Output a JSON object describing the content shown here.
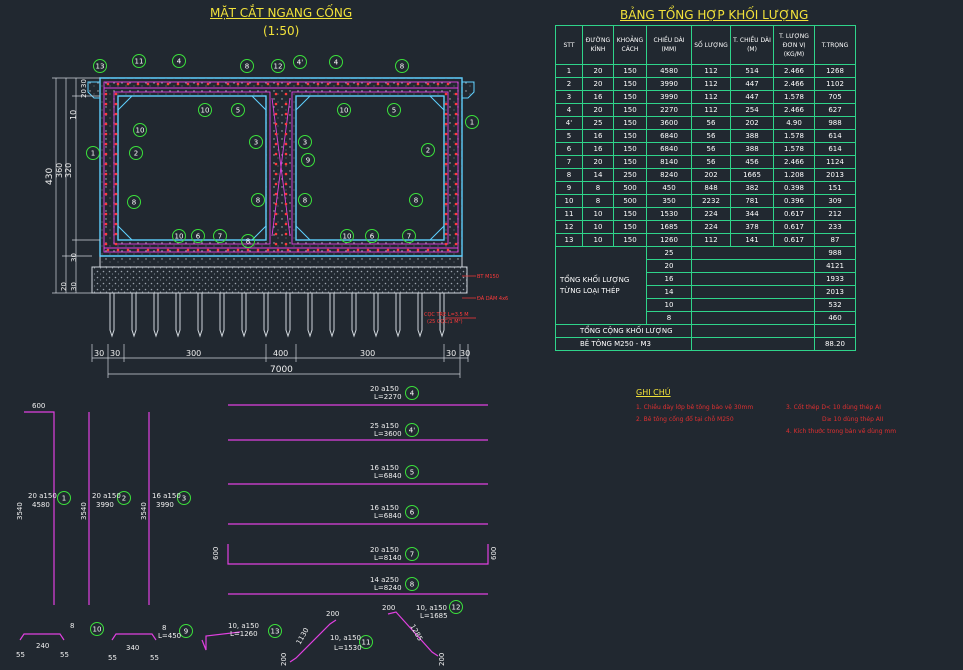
{
  "drawing": {
    "section_title": "MẶT CẮT NGANG CỐNG",
    "section_scale": "(1:50)",
    "table_title": "BẢNG TỔNG HỢP KHỐI LƯỢNG",
    "dims_left": [
      "430",
      "20",
      "30",
      "10",
      "320",
      "360",
      "30",
      "20",
      "30"
    ],
    "dims_bottom": [
      "30",
      "30",
      "300",
      "400",
      "300",
      "30",
      "30"
    ],
    "dim_total": "7000",
    "annotations": [
      "BT M150",
      "ĐÁ DĂM 4x6",
      "CỌC TRE L=3.5 M",
      "(25 CỌC/1 M²)"
    ],
    "bubbles_top": [
      "13",
      "11",
      "4",
      "8",
      "12",
      "4'",
      "4",
      "8"
    ],
    "bubbles_mid": [
      "5",
      "10",
      "5",
      "10",
      "10",
      "1",
      "2",
      "3",
      "3",
      "9",
      "2",
      "1",
      "8",
      "8",
      "8",
      "8"
    ],
    "bubbles_low": [
      "10",
      "6",
      "7",
      "8",
      "10",
      "6",
      "7"
    ]
  },
  "table": {
    "headers": [
      "STT",
      "ĐƯỜNG KÍNH",
      "KHOẢNG CÁCH",
      "CHIỀU DÀI (MM)",
      "SỐ LƯỢNG",
      "T. CHIỀU DÀI (M)",
      "T. LƯỢNG ĐƠN VỊ (KG/M)",
      "T.TRỌNG"
    ],
    "rows": [
      [
        "1",
        "20",
        "150",
        "4580",
        "112",
        "514",
        "2.466",
        "1268"
      ],
      [
        "2",
        "20",
        "150",
        "3990",
        "112",
        "447",
        "2.466",
        "1102"
      ],
      [
        "3",
        "16",
        "150",
        "3990",
        "112",
        "447",
        "1.578",
        "705"
      ],
      [
        "4",
        "20",
        "150",
        "2270",
        "112",
        "254",
        "2.466",
        "627"
      ],
      [
        "4'",
        "25",
        "150",
        "3600",
        "56",
        "202",
        "4.90",
        "988"
      ],
      [
        "5",
        "16",
        "150",
        "6840",
        "56",
        "388",
        "1.578",
        "614"
      ],
      [
        "6",
        "16",
        "150",
        "6840",
        "56",
        "388",
        "1.578",
        "614"
      ],
      [
        "7",
        "20",
        "150",
        "8140",
        "56",
        "456",
        "2.466",
        "1124"
      ],
      [
        "8",
        "14",
        "250",
        "8240",
        "202",
        "1665",
        "1.208",
        "2013"
      ],
      [
        "9",
        "8",
        "500",
        "450",
        "848",
        "382",
        "0.398",
        "151"
      ],
      [
        "10",
        "8",
        "500",
        "350",
        "2232",
        "781",
        "0.396",
        "309"
      ],
      [
        "11",
        "10",
        "150",
        "1530",
        "224",
        "344",
        "0.617",
        "212"
      ],
      [
        "12",
        "10",
        "150",
        "1685",
        "224",
        "378",
        "0.617",
        "233"
      ],
      [
        "13",
        "10",
        "150",
        "1260",
        "112",
        "141",
        "0.617",
        "87"
      ]
    ],
    "summary_label": "TỔNG KHỐI LƯỢNG TỪNG LOẠI THÉP",
    "summary": [
      [
        "25",
        "988"
      ],
      [
        "20",
        "4121"
      ],
      [
        "16",
        "1933"
      ],
      [
        "14",
        "2013"
      ],
      [
        "10",
        "532"
      ],
      [
        "8",
        "460"
      ]
    ],
    "total_label": "TỔNG CỘNG KHỐI LƯỢNG",
    "total_value": "",
    "concrete_label": "BÊ TÔNG M250 - M3",
    "concrete_value": "88.20"
  },
  "notes": {
    "title": "GHI CHÚ",
    "items": [
      "1. Chiều dày lớp bê tông bảo vệ 30mm",
      "2. Bê tông cống đổ tại chỗ M250",
      "3. Cốt thép D< 10 dùng thép AI",
      "D≥ 10 dùng thép AII",
      "4. Kích thước trong bản vẽ dùng mm"
    ]
  },
  "bars": [
    {
      "label": "20 a150",
      "length": "L=2270",
      "id": "4"
    },
    {
      "label": "25 a150",
      "length": "L=3600",
      "id": "4'"
    },
    {
      "label": "16 a150",
      "length": "L=6840",
      "id": "5"
    },
    {
      "label": "16 a150",
      "length": "L=6840",
      "id": "6"
    },
    {
      "label": "20 a150",
      "length": "L=8140",
      "id": "7"
    },
    {
      "label": "14 a250",
      "length": "L=8240",
      "id": "8"
    }
  ],
  "vbars": [
    {
      "dim": "3540",
      "label": "20 a150",
      "length": "4580",
      "id": "1",
      "top": "600"
    },
    {
      "dim": "3540",
      "label": "20 a150",
      "length": "3990",
      "id": "2"
    },
    {
      "dim": "3540",
      "label": "16 a150",
      "length": "3990",
      "id": "3"
    }
  ],
  "bottom_bars": [
    {
      "label": "8",
      "id": "10",
      "d1": "240",
      "d2": "55",
      "d3": "55"
    },
    {
      "label": "8",
      "length": "L=450",
      "id": "9",
      "d1": "340",
      "d2": "55",
      "d3": "55"
    },
    {
      "label": "10, a150",
      "length": "L=1260",
      "id": "13"
    },
    {
      "label": "10, a150",
      "length": "L=1530",
      "id": "11",
      "d1": "200",
      "d2": "1130",
      "d3": "200"
    },
    {
      "label": "10, a150",
      "length": "L=1685",
      "id": "12",
      "d1": "200",
      "d2": "1285",
      "d3": "200"
    }
  ],
  "side_dims": [
    "600",
    "600"
  ]
}
